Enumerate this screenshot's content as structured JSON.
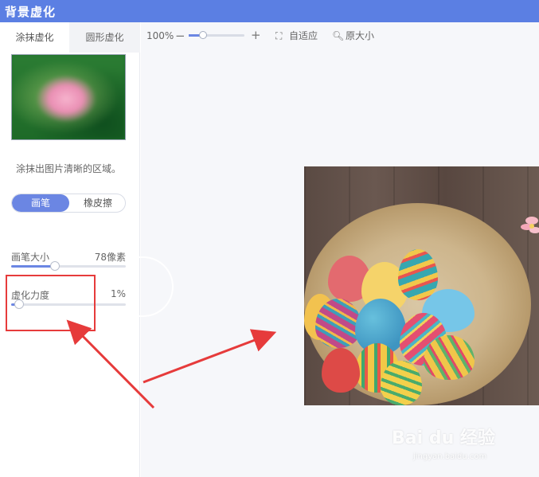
{
  "titlebar": {
    "title": "背景虚化"
  },
  "tabs": [
    {
      "label": "涂抹虚化"
    },
    {
      "label": "圆形虚化"
    }
  ],
  "sidebar": {
    "hint": "涂抹出图片清晰的区域。",
    "mode": {
      "brush_label": "画笔",
      "eraser_label": "橡皮擦"
    },
    "brush_size": {
      "label": "画笔大小",
      "value_text": "78像素",
      "fraction": 0.38
    },
    "blur_strength": {
      "label": "虚化力度",
      "value_text": "1%",
      "fraction": 0.01
    }
  },
  "toolbar": {
    "zoom_text": "100%",
    "zoom_fraction": 0.25,
    "fit_label": "自适应",
    "original_label": "原大小"
  },
  "watermark": {
    "text": "Bai du 经验",
    "sub": "jingyan.baidu.com"
  },
  "colors": {
    "accent": "#5b7fe3",
    "annotation": "#e63b3b"
  }
}
